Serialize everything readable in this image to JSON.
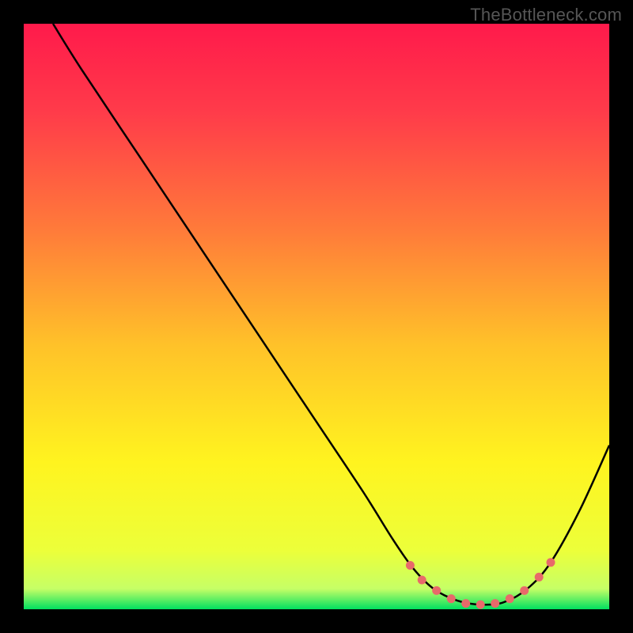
{
  "watermark": "TheBottleneck.com",
  "chart_data": {
    "type": "line",
    "title": "",
    "xlabel": "",
    "ylabel": "",
    "xlim": [
      0,
      100
    ],
    "ylim": [
      0,
      100
    ],
    "curve": {
      "description": "V-shaped curve: steep linear descent from top-left, flat trough near bottom-right, rise to mid-right edge",
      "points_pct": [
        [
          5.0,
          100.0
        ],
        [
          10.0,
          92.0
        ],
        [
          20.0,
          77.0
        ],
        [
          30.0,
          62.0
        ],
        [
          40.0,
          47.0
        ],
        [
          50.0,
          32.0
        ],
        [
          58.0,
          20.0
        ],
        [
          63.0,
          12.0
        ],
        [
          66.5,
          7.0
        ],
        [
          70.0,
          3.5
        ],
        [
          74.0,
          1.5
        ],
        [
          78.0,
          0.8
        ],
        [
          82.0,
          1.2
        ],
        [
          86.0,
          3.5
        ],
        [
          90.0,
          8.0
        ],
        [
          95.0,
          17.0
        ],
        [
          100.0,
          28.0
        ]
      ]
    },
    "trough_markers_pct": [
      [
        66.0,
        7.5
      ],
      [
        68.0,
        5.0
      ],
      [
        70.5,
        3.2
      ],
      [
        73.0,
        1.8
      ],
      [
        75.5,
        1.0
      ],
      [
        78.0,
        0.8
      ],
      [
        80.5,
        1.0
      ],
      [
        83.0,
        1.8
      ],
      [
        85.5,
        3.2
      ],
      [
        88.0,
        5.5
      ],
      [
        90.0,
        8.0
      ]
    ],
    "background_gradient_stops": [
      {
        "offset": 0.0,
        "color": "#ff1a4b"
      },
      {
        "offset": 0.15,
        "color": "#ff3b4a"
      },
      {
        "offset": 0.35,
        "color": "#ff7a3a"
      },
      {
        "offset": 0.55,
        "color": "#ffc229"
      },
      {
        "offset": 0.75,
        "color": "#fff41f"
      },
      {
        "offset": 0.9,
        "color": "#ecff3a"
      },
      {
        "offset": 0.965,
        "color": "#c6ff66"
      },
      {
        "offset": 1.0,
        "color": "#00e060"
      }
    ]
  }
}
